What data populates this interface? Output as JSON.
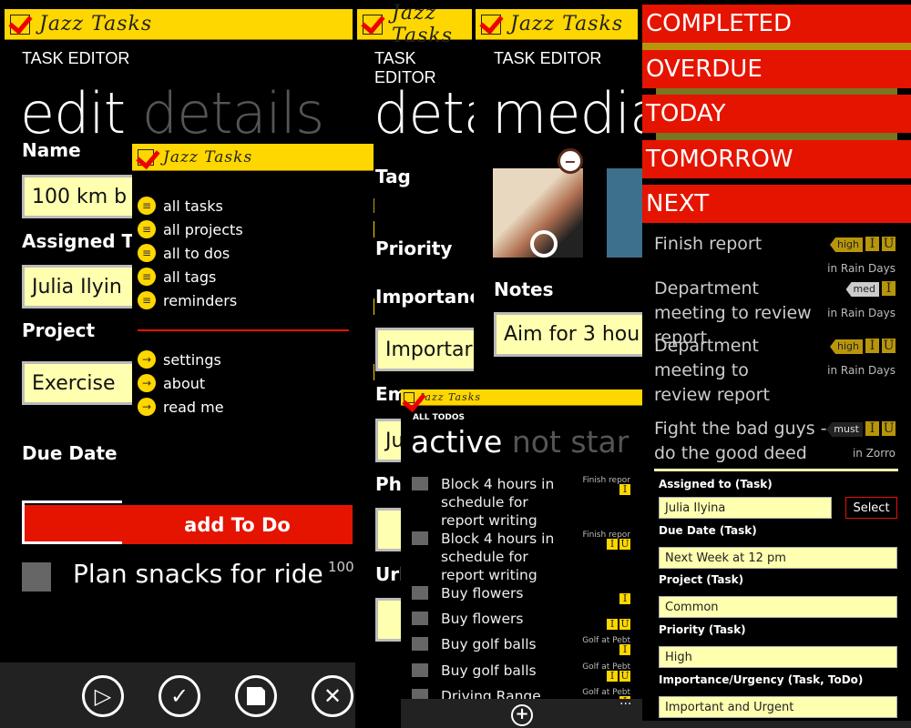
{
  "app_title": "Jazz Tasks",
  "editor": {
    "caption": "TASK EDITOR",
    "pivot_active": "edit",
    "pivot_next": "details",
    "fields": {
      "name_label": "Name",
      "name_value": "100 km b",
      "assigned_label": "Assigned T",
      "assigned_value": "Julia Ilyin",
      "project_label": "Project",
      "project_value": "Exercise",
      "due_label": "Due Date"
    },
    "add_todo": "add To Do",
    "todo_item": "Plan snacks for ride",
    "todo_value": "100",
    "appbar": [
      "play-icon",
      "check-icon",
      "save-icon",
      "close-icon"
    ]
  },
  "menu": {
    "items": [
      "all tasks",
      "all projects",
      "all to dos",
      "all tags",
      "reminders"
    ],
    "links": [
      "settings",
      "about",
      "read me"
    ]
  },
  "details": {
    "caption": "TASK EDITOR",
    "pivot": "deta",
    "tag_label": "Tag",
    "priority_label": "Priority",
    "importance_label": "Importanc",
    "importance_value": "Importar",
    "email_label": "Em",
    "email_value": "Ju",
    "phone_label": "Ph",
    "url_label": "Url"
  },
  "media": {
    "caption": "TASK EDITOR",
    "pivot": "media",
    "notes_label": "Notes",
    "notes_value": "Aim for 3 hou"
  },
  "todos": {
    "caption": "ALL TODOS",
    "pivot_active": "active",
    "pivot_next": "not star",
    "items": [
      {
        "text": "Block 4 hours in schedule for report writing",
        "task": "Finish repor",
        "flags": [
          "I"
        ]
      },
      {
        "text": "Block 4 hours in schedule for report writing",
        "task": "Finish repor",
        "flags": [
          "I",
          "U"
        ]
      },
      {
        "text": "Buy flowers",
        "task": "",
        "flags": [
          "I"
        ]
      },
      {
        "text": "Buy flowers",
        "task": "",
        "flags": [
          "I",
          "U"
        ]
      },
      {
        "text": "Buy golf balls",
        "task": "Golf at Pebt",
        "flags": [
          "I"
        ]
      },
      {
        "text": "Buy golf balls",
        "task": "Golf at Pebt",
        "flags": [
          "I",
          "U"
        ]
      },
      {
        "text": "Driving Range",
        "task": "Golf at Pebt",
        "flags": [
          "I"
        ]
      }
    ],
    "more": "..."
  },
  "groups": [
    "COMPLETED",
    "OVERDUE",
    "TODAY",
    "TOMORROW",
    "NEXT"
  ],
  "tasks": [
    {
      "text": "Finish report",
      "priority": "high",
      "flags": [
        "I",
        "U"
      ],
      "project": "in Rain Days"
    },
    {
      "text": "Department meeting to review report",
      "priority": "med",
      "flags": [
        "I"
      ],
      "project": "in Rain Days"
    },
    {
      "text": "Department meeting to review report",
      "priority": "high",
      "flags": [
        "I",
        "U"
      ],
      "project": "in Rain Days"
    },
    {
      "text": "Fight the bad guys - do the good deed",
      "priority": "must",
      "flags": [
        "I",
        "U"
      ],
      "project": "in Zorro"
    }
  ],
  "form": {
    "assigned_label": "Assigned to (Task)",
    "assigned_value": "Julia Ilyina",
    "select": "Select",
    "due_label": "Due Date (Task)",
    "due_value": "Next Week at 12 pm",
    "project_label": "Project (Task)",
    "project_value": "Common",
    "priority_label": "Priority (Task)",
    "priority_value": "High",
    "iu_label": "Importance/Urgency (Task, ToDo)",
    "iu_value": "Important and Urgent"
  },
  "colors": {
    "header": "#ffd700",
    "accent": "#e51400",
    "input": "#ffffb0",
    "appbar": "#222222"
  }
}
